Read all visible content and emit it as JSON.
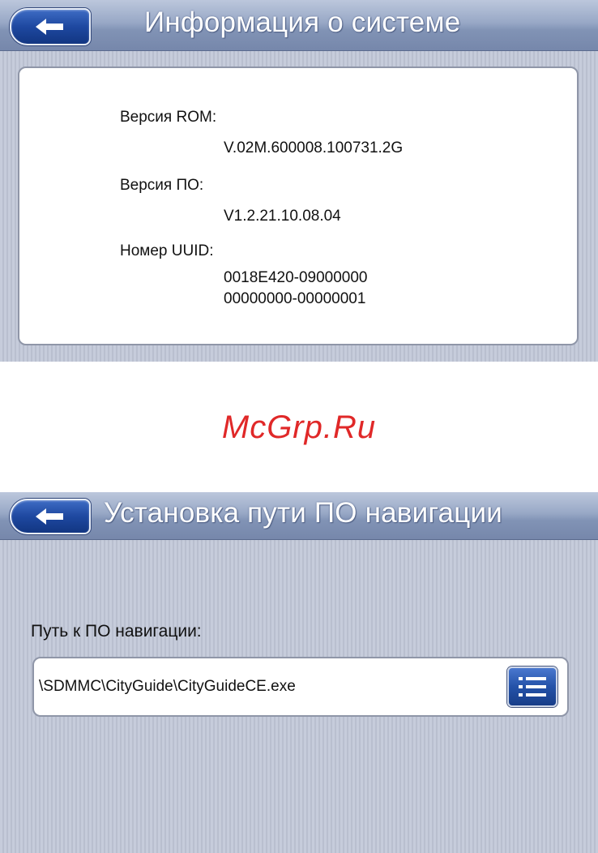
{
  "system_info_screen": {
    "title": "Информация о системе",
    "rom_version_label": "Версия ROM:",
    "rom_version_value": "V.02M.600008.100731.2G",
    "software_version_label": "Версия ПО:",
    "software_version_value": "V1.2.21.10.08.04",
    "uuid_label": "Номер UUID:",
    "uuid_value_line1": "0018E420-09000000",
    "uuid_value_line2": "00000000-00000001"
  },
  "watermark": "McGrp.Ru",
  "navigation_path_screen": {
    "title": "Установка пути ПО навигации",
    "path_label": "Путь к ПО навигации:",
    "path_value": "\\SDMMC\\CityGuide\\CityGuideCE.exe"
  },
  "icons": {
    "back": "arrow-left-icon",
    "browse": "list-icon"
  },
  "colors": {
    "accent_button": "#1e48a0",
    "watermark": "#e02828"
  }
}
